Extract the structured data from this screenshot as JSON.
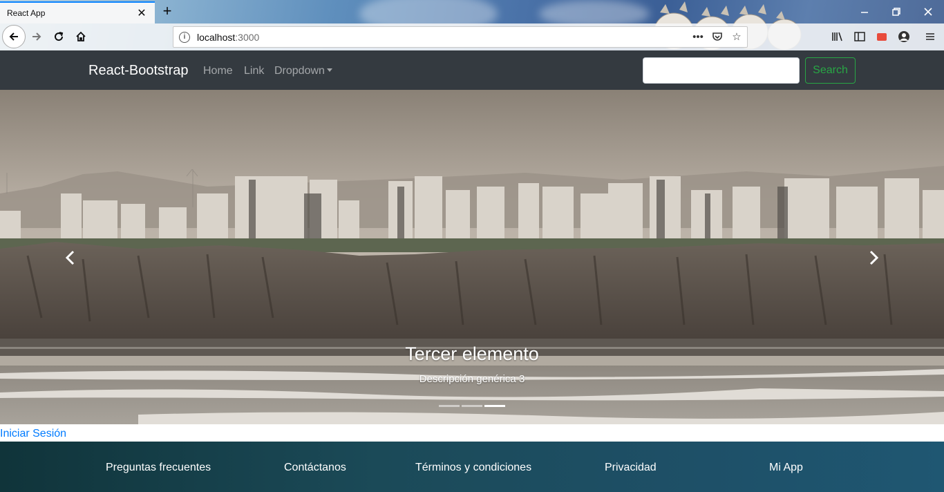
{
  "browser": {
    "tab_title": "React App",
    "url_host": "localhost",
    "url_port": ":3000"
  },
  "navbar": {
    "brand": "React-Bootstrap",
    "links": [
      "Home",
      "Link",
      "Dropdown"
    ],
    "search_value": "",
    "search_button": "Search"
  },
  "carousel": {
    "caption_title": "Tercer elemento",
    "caption_text": "Descripción genérica 3",
    "indicator_count": 3,
    "active_index": 2
  },
  "login_link": "Iniciar Sesión",
  "footer": {
    "links": [
      "Preguntas frecuentes",
      "Contáctanos",
      "Términos y condiciones",
      "Privacidad",
      "Mi App"
    ]
  },
  "colors": {
    "navbar_bg": "#343a40",
    "search_accent": "#28a745",
    "link_blue": "#007bff",
    "tab_accent": "#0a84ff"
  },
  "icons": [
    "back-arrow-icon",
    "forward-arrow-icon",
    "reload-icon",
    "home-icon",
    "info-icon",
    "more-icon",
    "pocket-icon",
    "star-icon",
    "library-icon",
    "sidebar-icon",
    "screenshot-icon",
    "account-icon",
    "menu-icon",
    "close-icon",
    "plus-icon",
    "minimize-icon",
    "restore-icon",
    "window-close-icon",
    "chevron-left-icon",
    "chevron-right-icon"
  ]
}
